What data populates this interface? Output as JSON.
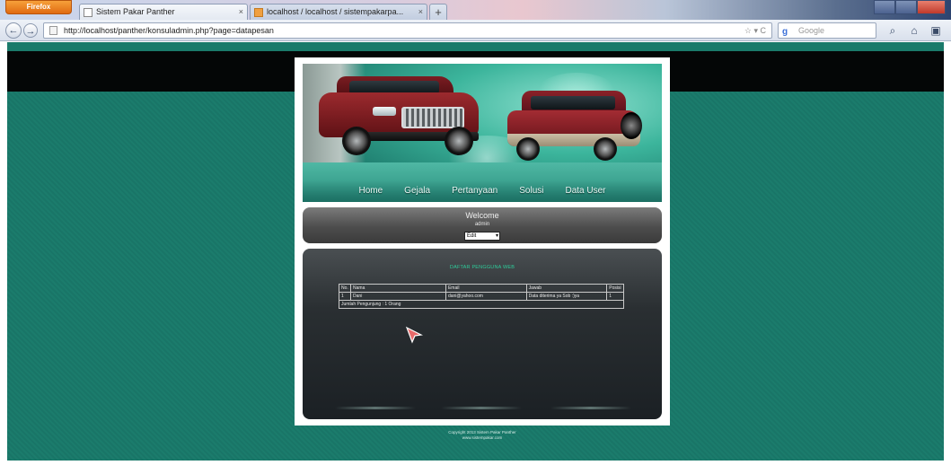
{
  "browser": {
    "firefox_button": "Firefox",
    "tabs": [
      {
        "title": "Sistem Pakar Panther"
      },
      {
        "title": "localhost / localhost / sistempakarpa..."
      }
    ],
    "tab_close": "×",
    "new_tab": "+",
    "url": "http://localhost/panther/konsuladmin.php?page=datapesan",
    "search_placeholder": "Google",
    "search_engine_icon": "google-g-icon",
    "nav_back": "←",
    "nav_forward": "→",
    "url_tools": "☆ ▾ C",
    "home_icon": "⌂",
    "bookmark_icon": "▣"
  },
  "site": {
    "menu": [
      {
        "label": "Home"
      },
      {
        "label": "Gejala"
      },
      {
        "label": "Pertanyaan"
      },
      {
        "label": "Solusi"
      },
      {
        "label": "Data User"
      }
    ],
    "welcome": {
      "title": "Welcome",
      "user": "admin",
      "select_value": "Edit"
    },
    "content": {
      "title": "DAFTAR PENGGUNA WEB",
      "columns": [
        "No.",
        "Nama",
        "Email",
        "Jawab",
        "Posisi"
      ],
      "rows": [
        {
          "no": "1",
          "nama": "Dani",
          "email": "dani@yahoo.com",
          "jawab": "Data diterima ya Sob :)ya",
          "pos": "1"
        }
      ],
      "summary": "Jumlah Pengunjung : 1 Orang"
    },
    "copyright": [
      "Copyright 2013 Sistem Pakar Panther",
      "www.sistempakar.com"
    ]
  },
  "colors": {
    "page_background": "#1a7a6a",
    "top_strip": "#040606",
    "content_title": "#2ecc9a"
  }
}
